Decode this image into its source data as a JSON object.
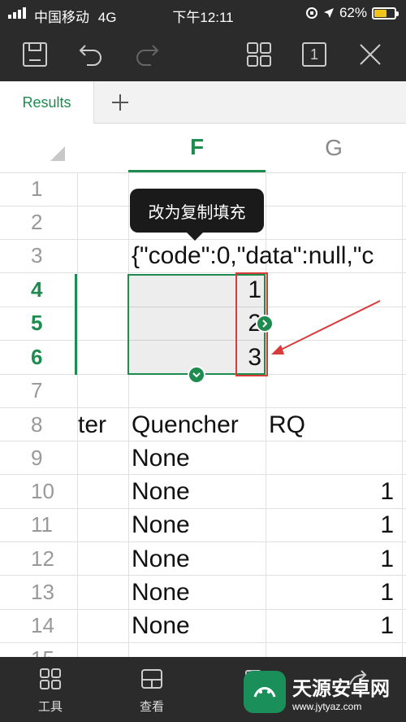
{
  "status_bar": {
    "carrier": "中国移动",
    "network": "4G",
    "time": "下午12:11",
    "battery": "62%",
    "battery_level": 0.62
  },
  "toolbar": {
    "icons": [
      "save-icon",
      "undo-icon",
      "redo-icon",
      "grid-view-icon",
      "sheet-count-icon",
      "close-icon"
    ],
    "sheet_count": "1"
  },
  "tabs": {
    "active": "Results",
    "add": "+"
  },
  "grid": {
    "columns": [
      "F",
      "G"
    ],
    "active_column": "F",
    "rows": [
      "1",
      "2",
      "3",
      "4",
      "5",
      "6",
      "7",
      "8",
      "9",
      "10",
      "11",
      "12",
      "13",
      "14",
      "15"
    ],
    "active_rows": [
      "4",
      "5",
      "6"
    ],
    "cells": {
      "r3_f": "{\"code\":0,\"data\":null,\"c",
      "r4_g": "1",
      "r5_g": "2",
      "r6_g": "3",
      "r8_e": "ter",
      "r8_f": "Quencher",
      "r8_g": "RQ",
      "r9_f": "None",
      "r10_f": "None",
      "r10_g": "1",
      "r11_f": "None",
      "r11_g": "1",
      "r12_f": "None",
      "r12_g": "1",
      "r13_f": "None",
      "r13_g": "1",
      "r14_f": "None",
      "r14_g": "1"
    }
  },
  "tooltip": "改为复制填充",
  "bottom_bar": {
    "items": [
      {
        "label": "工具",
        "icon": "tools-icon"
      },
      {
        "label": "查看",
        "icon": "view-icon"
      }
    ]
  },
  "watermark": {
    "name": "天源安卓网",
    "url": "www.jytyaz.com"
  },
  "colors": {
    "accent": "#1e8b4f",
    "annotation": "#d93a3a",
    "chrome": "#2b2b2b"
  }
}
